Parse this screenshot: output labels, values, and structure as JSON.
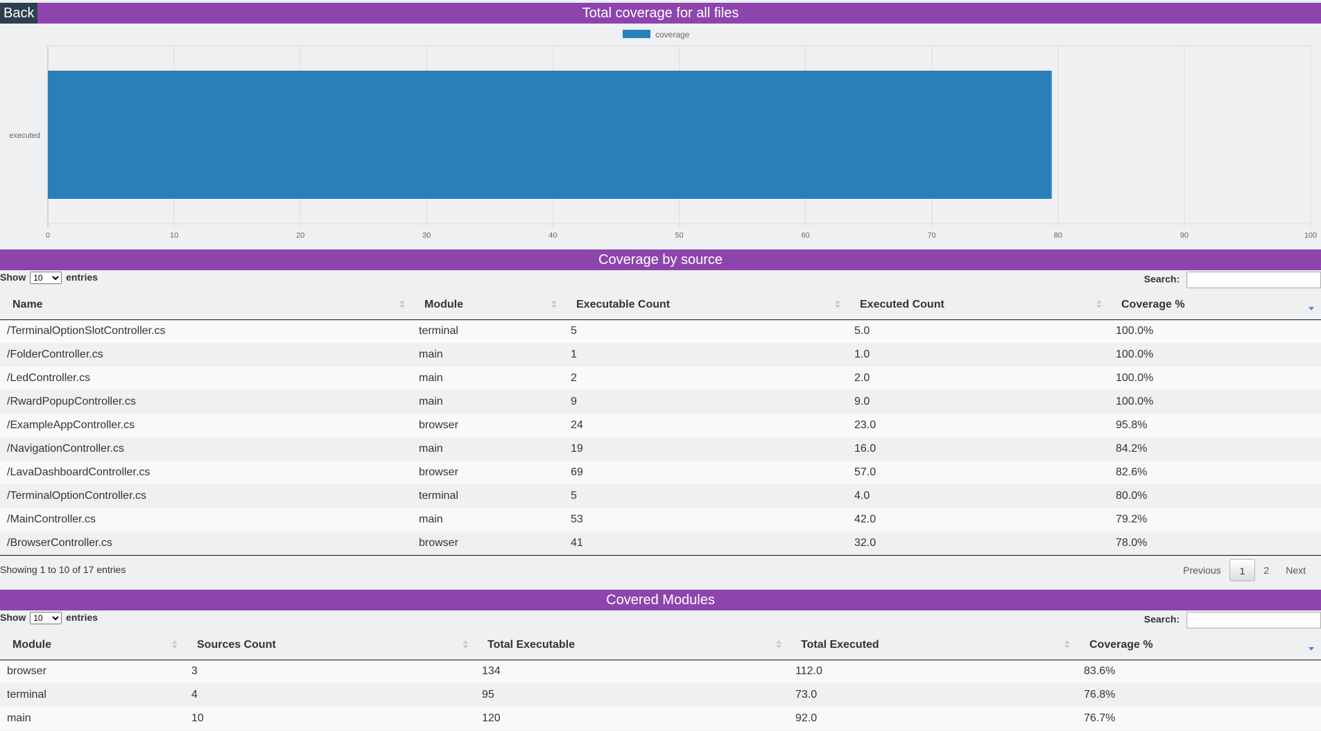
{
  "back_label": "Back",
  "chart_section": {
    "title": "Total coverage for all files"
  },
  "chart_data": {
    "type": "bar",
    "orientation": "horizontal",
    "categories": [
      "executed"
    ],
    "series": [
      {
        "name": "coverage",
        "values": [
          79.5
        ]
      }
    ],
    "xlim": [
      0,
      100
    ],
    "xticks": [
      "0",
      "10",
      "20",
      "30",
      "40",
      "50",
      "60",
      "70",
      "80",
      "90",
      "100"
    ],
    "grid": true,
    "legend": "top-center",
    "color": "#2980b9"
  },
  "sources_section": {
    "title": "Coverage by source",
    "show_label": "Show",
    "entries_label": "entries",
    "page_size": "10",
    "search_label": "Search:",
    "search_value": "",
    "columns": [
      "Name",
      "Module",
      "Executable Count",
      "Executed Count",
      "Coverage %"
    ],
    "rows": [
      [
        "/TerminalOptionSlotController.cs",
        "terminal",
        "5",
        "5.0",
        "100.0%"
      ],
      [
        "/FolderController.cs",
        "main",
        "1",
        "1.0",
        "100.0%"
      ],
      [
        "/LedController.cs",
        "main",
        "2",
        "2.0",
        "100.0%"
      ],
      [
        "/RwardPopupController.cs",
        "main",
        "9",
        "9.0",
        "100.0%"
      ],
      [
        "/ExampleAppController.cs",
        "browser",
        "24",
        "23.0",
        "95.8%"
      ],
      [
        "/NavigationController.cs",
        "main",
        "19",
        "16.0",
        "84.2%"
      ],
      [
        "/LavaDashboardController.cs",
        "browser",
        "69",
        "57.0",
        "82.6%"
      ],
      [
        "/TerminalOptionController.cs",
        "terminal",
        "5",
        "4.0",
        "80.0%"
      ],
      [
        "/MainController.cs",
        "main",
        "53",
        "42.0",
        "79.2%"
      ],
      [
        "/BrowserController.cs",
        "browser",
        "41",
        "32.0",
        "78.0%"
      ]
    ],
    "info": "Showing 1 to 10 of 17 entries",
    "pager": {
      "previous": "Previous",
      "pages": [
        "1",
        "2"
      ],
      "current": "1",
      "next": "Next"
    }
  },
  "modules_section": {
    "title": "Covered Modules",
    "show_label": "Show",
    "entries_label": "entries",
    "page_size": "10",
    "search_label": "Search:",
    "search_value": "",
    "columns": [
      "Module",
      "Sources Count",
      "Total Executable",
      "Total Executed",
      "Coverage %"
    ],
    "rows": [
      [
        "browser",
        "3",
        "134",
        "112.0",
        "83.6%"
      ],
      [
        "terminal",
        "4",
        "95",
        "73.0",
        "76.8%"
      ],
      [
        "main",
        "10",
        "120",
        "92.0",
        "76.7%"
      ]
    ]
  }
}
